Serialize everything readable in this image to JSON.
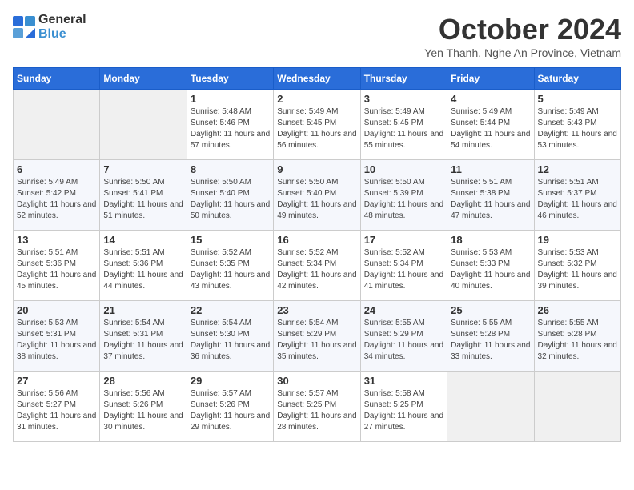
{
  "logo": {
    "text_general": "General",
    "text_blue": "Blue"
  },
  "header": {
    "month": "October 2024",
    "location": "Yen Thanh, Nghe An Province, Vietnam"
  },
  "weekdays": [
    "Sunday",
    "Monday",
    "Tuesday",
    "Wednesday",
    "Thursday",
    "Friday",
    "Saturday"
  ],
  "weeks": [
    [
      {
        "day": "",
        "empty": true
      },
      {
        "day": "",
        "empty": true
      },
      {
        "day": "1",
        "sunrise": "5:48 AM",
        "sunset": "5:46 PM",
        "daylight": "11 hours and 57 minutes."
      },
      {
        "day": "2",
        "sunrise": "5:49 AM",
        "sunset": "5:45 PM",
        "daylight": "11 hours and 56 minutes."
      },
      {
        "day": "3",
        "sunrise": "5:49 AM",
        "sunset": "5:45 PM",
        "daylight": "11 hours and 55 minutes."
      },
      {
        "day": "4",
        "sunrise": "5:49 AM",
        "sunset": "5:44 PM",
        "daylight": "11 hours and 54 minutes."
      },
      {
        "day": "5",
        "sunrise": "5:49 AM",
        "sunset": "5:43 PM",
        "daylight": "11 hours and 53 minutes."
      }
    ],
    [
      {
        "day": "6",
        "sunrise": "5:49 AM",
        "sunset": "5:42 PM",
        "daylight": "11 hours and 52 minutes."
      },
      {
        "day": "7",
        "sunrise": "5:50 AM",
        "sunset": "5:41 PM",
        "daylight": "11 hours and 51 minutes."
      },
      {
        "day": "8",
        "sunrise": "5:50 AM",
        "sunset": "5:40 PM",
        "daylight": "11 hours and 50 minutes."
      },
      {
        "day": "9",
        "sunrise": "5:50 AM",
        "sunset": "5:40 PM",
        "daylight": "11 hours and 49 minutes."
      },
      {
        "day": "10",
        "sunrise": "5:50 AM",
        "sunset": "5:39 PM",
        "daylight": "11 hours and 48 minutes."
      },
      {
        "day": "11",
        "sunrise": "5:51 AM",
        "sunset": "5:38 PM",
        "daylight": "11 hours and 47 minutes."
      },
      {
        "day": "12",
        "sunrise": "5:51 AM",
        "sunset": "5:37 PM",
        "daylight": "11 hours and 46 minutes."
      }
    ],
    [
      {
        "day": "13",
        "sunrise": "5:51 AM",
        "sunset": "5:36 PM",
        "daylight": "11 hours and 45 minutes."
      },
      {
        "day": "14",
        "sunrise": "5:51 AM",
        "sunset": "5:36 PM",
        "daylight": "11 hours and 44 minutes."
      },
      {
        "day": "15",
        "sunrise": "5:52 AM",
        "sunset": "5:35 PM",
        "daylight": "11 hours and 43 minutes."
      },
      {
        "day": "16",
        "sunrise": "5:52 AM",
        "sunset": "5:34 PM",
        "daylight": "11 hours and 42 minutes."
      },
      {
        "day": "17",
        "sunrise": "5:52 AM",
        "sunset": "5:34 PM",
        "daylight": "11 hours and 41 minutes."
      },
      {
        "day": "18",
        "sunrise": "5:53 AM",
        "sunset": "5:33 PM",
        "daylight": "11 hours and 40 minutes."
      },
      {
        "day": "19",
        "sunrise": "5:53 AM",
        "sunset": "5:32 PM",
        "daylight": "11 hours and 39 minutes."
      }
    ],
    [
      {
        "day": "20",
        "sunrise": "5:53 AM",
        "sunset": "5:31 PM",
        "daylight": "11 hours and 38 minutes."
      },
      {
        "day": "21",
        "sunrise": "5:54 AM",
        "sunset": "5:31 PM",
        "daylight": "11 hours and 37 minutes."
      },
      {
        "day": "22",
        "sunrise": "5:54 AM",
        "sunset": "5:30 PM",
        "daylight": "11 hours and 36 minutes."
      },
      {
        "day": "23",
        "sunrise": "5:54 AM",
        "sunset": "5:29 PM",
        "daylight": "11 hours and 35 minutes."
      },
      {
        "day": "24",
        "sunrise": "5:55 AM",
        "sunset": "5:29 PM",
        "daylight": "11 hours and 34 minutes."
      },
      {
        "day": "25",
        "sunrise": "5:55 AM",
        "sunset": "5:28 PM",
        "daylight": "11 hours and 33 minutes."
      },
      {
        "day": "26",
        "sunrise": "5:55 AM",
        "sunset": "5:28 PM",
        "daylight": "11 hours and 32 minutes."
      }
    ],
    [
      {
        "day": "27",
        "sunrise": "5:56 AM",
        "sunset": "5:27 PM",
        "daylight": "11 hours and 31 minutes."
      },
      {
        "day": "28",
        "sunrise": "5:56 AM",
        "sunset": "5:26 PM",
        "daylight": "11 hours and 30 minutes."
      },
      {
        "day": "29",
        "sunrise": "5:57 AM",
        "sunset": "5:26 PM",
        "daylight": "11 hours and 29 minutes."
      },
      {
        "day": "30",
        "sunrise": "5:57 AM",
        "sunset": "5:25 PM",
        "daylight": "11 hours and 28 minutes."
      },
      {
        "day": "31",
        "sunrise": "5:58 AM",
        "sunset": "5:25 PM",
        "daylight": "11 hours and 27 minutes."
      },
      {
        "day": "",
        "empty": true
      },
      {
        "day": "",
        "empty": true
      }
    ]
  ]
}
